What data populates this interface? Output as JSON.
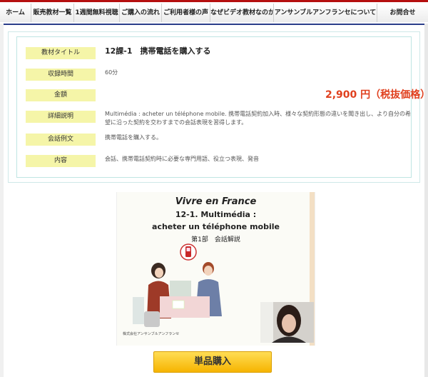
{
  "nav": {
    "items": [
      {
        "label": "ホーム"
      },
      {
        "label": "販売教材一覧"
      },
      {
        "label": "1週間無料視聴"
      },
      {
        "label": "ご購入の流れ"
      },
      {
        "label": "ご利用者様の声"
      },
      {
        "label": "なぜビデオ教材なのか"
      },
      {
        "label": "アンサンブルアンフランセについて"
      },
      {
        "label": "お問合せ"
      }
    ]
  },
  "info": {
    "title_label": "教材タイトル",
    "title_value": "12課-1　携帯電話を購入する",
    "duration_label": "収録時間",
    "duration_value": "60分",
    "price_label": "金額",
    "price_value": "2,900 円（税抜価格）",
    "detail_label": "詳細説明",
    "detail_value": "Multimédia : acheter un téléphone mobile. 携帯電話契約加入時、様々な契約形態の違いを聞き出し、より自分の希望に沿った契約を交わすまでの会話表現を習得します。",
    "dialogue_label": "会話例文",
    "dialogue_value": "携帯電話を購入する。",
    "content_label": "内容",
    "content_value": "会話、携帯電話契約時に必要な専門用語、役立つ表現、発音"
  },
  "thumbnail": {
    "title": "Vivre en France",
    "subtitle1": "12-1. Multimédia :",
    "subtitle2": "acheter un téléphone mobile",
    "part": "第1部　会話解説",
    "company": "株式会社アンサンブルアンフランセ"
  },
  "buy_button": "単品購入",
  "colors": {
    "accent": "#b50f0f",
    "nav_bottom": "#2a3d8a",
    "label_bg": "#f5f5a8",
    "price": "#e0401e",
    "button": "#f6b400"
  }
}
